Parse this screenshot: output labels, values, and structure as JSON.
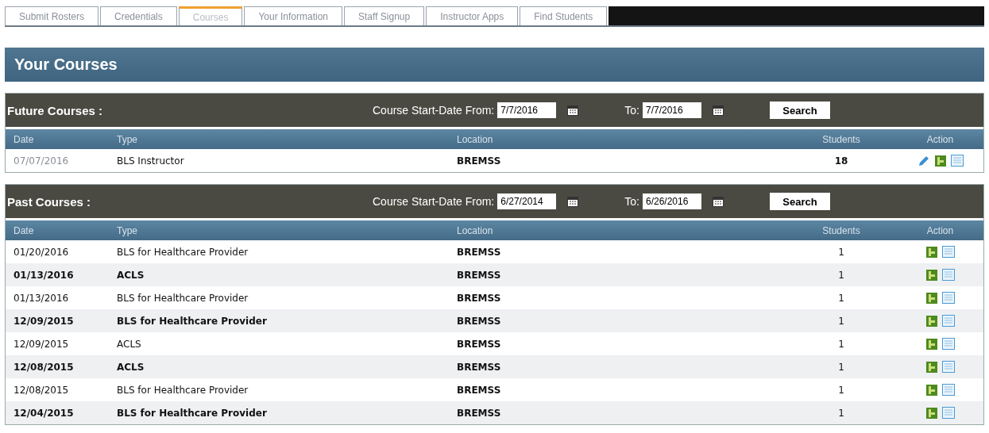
{
  "tabs": [
    {
      "label": "Submit Rosters",
      "selected": false
    },
    {
      "label": "Credentials",
      "selected": false
    },
    {
      "label": "Courses",
      "selected": true
    },
    {
      "label": "Your Information",
      "selected": false
    },
    {
      "label": "Staff Signup",
      "selected": false
    },
    {
      "label": "Instructor Apps",
      "selected": false
    },
    {
      "label": "Find Students",
      "selected": false
    }
  ],
  "page_title": "Your Courses",
  "sections": [
    {
      "title": "Future Courses :",
      "from_label": "Course Start-Date From:",
      "from_value": "7/7/2016",
      "to_label": "To:",
      "to_value": "7/7/2016",
      "search_button": "Search",
      "columns": [
        "Date",
        "Type",
        "Location",
        "Students",
        "Action"
      ],
      "rows": [
        {
          "date": "07/07/2016",
          "type": "BLS Instructor",
          "location": "BREMSS",
          "students": "18",
          "editable": true
        }
      ]
    },
    {
      "title": "Past Courses :",
      "from_label": "Course Start-Date From:",
      "from_value": "6/27/2014",
      "to_label": "To:",
      "to_value": "6/26/2016",
      "search_button": "Search",
      "columns": [
        "Date",
        "Type",
        "Location",
        "Students",
        "Action"
      ],
      "rows": [
        {
          "date": "01/20/2016",
          "type": "BLS for Healthcare Provider",
          "location": "BREMSS",
          "students": "1",
          "editable": false
        },
        {
          "date": "01/13/2016",
          "type": "ACLS",
          "location": "BREMSS",
          "students": "1",
          "editable": false
        },
        {
          "date": "01/13/2016",
          "type": "BLS for Healthcare Provider",
          "location": "BREMSS",
          "students": "1",
          "editable": false
        },
        {
          "date": "12/09/2015",
          "type": "BLS for Healthcare Provider",
          "location": "BREMSS",
          "students": "1",
          "editable": false
        },
        {
          "date": "12/09/2015",
          "type": "ACLS",
          "location": "BREMSS",
          "students": "1",
          "editable": false
        },
        {
          "date": "12/08/2015",
          "type": "ACLS",
          "location": "BREMSS",
          "students": "1",
          "editable": false
        },
        {
          "date": "12/08/2015",
          "type": "BLS for Healthcare Provider",
          "location": "BREMSS",
          "students": "1",
          "editable": false
        },
        {
          "date": "12/04/2015",
          "type": "BLS for Healthcare Provider",
          "location": "BREMSS",
          "students": "1",
          "editable": false
        }
      ]
    }
  ]
}
